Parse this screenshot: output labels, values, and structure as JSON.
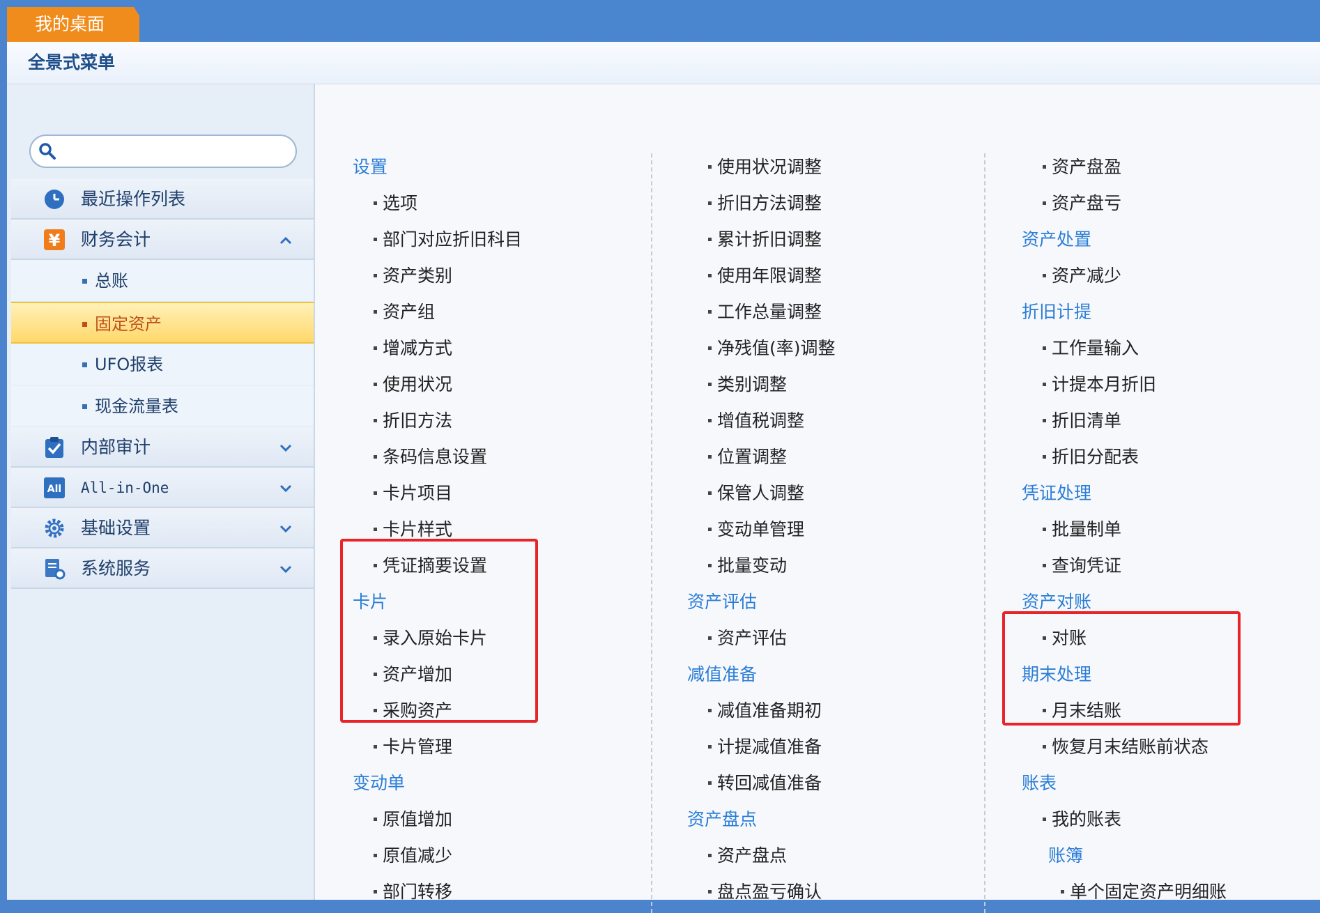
{
  "topbar": {
    "tab_label": "我的桌面"
  },
  "panel": {
    "title": "全景式菜单"
  },
  "search": {
    "placeholder": ""
  },
  "sidebar": {
    "groups": [
      {
        "label": "最近操作列表"
      },
      {
        "label": "财务会计",
        "expanded": true
      },
      {
        "label": "内部审计"
      },
      {
        "label": "All-in-One"
      },
      {
        "label": "基础设置"
      },
      {
        "label": "系统服务"
      }
    ],
    "sub_items": [
      {
        "label": "总账"
      },
      {
        "label": "固定资产",
        "active": true
      },
      {
        "label": "UFO报表"
      },
      {
        "label": "现金流量表"
      }
    ]
  },
  "columns": {
    "col1": [
      {
        "type": "head",
        "label": "设置"
      },
      {
        "type": "item",
        "label": "选项"
      },
      {
        "type": "item",
        "label": "部门对应折旧科目"
      },
      {
        "type": "item",
        "label": "资产类别"
      },
      {
        "type": "item",
        "label": "资产组"
      },
      {
        "type": "item",
        "label": "增减方式"
      },
      {
        "type": "item",
        "label": "使用状况"
      },
      {
        "type": "item",
        "label": "折旧方法"
      },
      {
        "type": "item",
        "label": "条码信息设置"
      },
      {
        "type": "item",
        "label": "卡片项目"
      },
      {
        "type": "item",
        "label": "卡片样式"
      },
      {
        "type": "item",
        "label": "凭证摘要设置"
      },
      {
        "type": "head",
        "label": "卡片"
      },
      {
        "type": "item",
        "label": "录入原始卡片"
      },
      {
        "type": "item",
        "label": "资产增加"
      },
      {
        "type": "item",
        "label": "采购资产"
      },
      {
        "type": "item",
        "label": "卡片管理"
      },
      {
        "type": "head",
        "label": "变动单"
      },
      {
        "type": "item",
        "label": "原值增加"
      },
      {
        "type": "item",
        "label": "原值减少"
      },
      {
        "type": "item",
        "label": "部门转移"
      }
    ],
    "col2": [
      {
        "type": "item",
        "label": "使用状况调整"
      },
      {
        "type": "item",
        "label": "折旧方法调整"
      },
      {
        "type": "item",
        "label": "累计折旧调整"
      },
      {
        "type": "item",
        "label": "使用年限调整"
      },
      {
        "type": "item",
        "label": "工作总量调整"
      },
      {
        "type": "item",
        "label": "净残值(率)调整"
      },
      {
        "type": "item",
        "label": "类别调整"
      },
      {
        "type": "item",
        "label": "增值税调整"
      },
      {
        "type": "item",
        "label": "位置调整"
      },
      {
        "type": "item",
        "label": "保管人调整"
      },
      {
        "type": "item",
        "label": "变动单管理"
      },
      {
        "type": "item",
        "label": "批量变动"
      },
      {
        "type": "head",
        "label": "资产评估"
      },
      {
        "type": "item",
        "label": "资产评估"
      },
      {
        "type": "head",
        "label": "减值准备"
      },
      {
        "type": "item",
        "label": "减值准备期初"
      },
      {
        "type": "item",
        "label": "计提减值准备"
      },
      {
        "type": "item",
        "label": "转回减值准备"
      },
      {
        "type": "head",
        "label": "资产盘点"
      },
      {
        "type": "item",
        "label": "资产盘点"
      },
      {
        "type": "item",
        "label": "盘点盈亏确认"
      }
    ],
    "col3": [
      {
        "type": "item",
        "label": "资产盘盈"
      },
      {
        "type": "item",
        "label": "资产盘亏"
      },
      {
        "type": "head",
        "label": "资产处置"
      },
      {
        "type": "item",
        "label": "资产减少"
      },
      {
        "type": "head",
        "label": "折旧计提"
      },
      {
        "type": "item",
        "label": "工作量输入"
      },
      {
        "type": "item",
        "label": "计提本月折旧"
      },
      {
        "type": "item",
        "label": "折旧清单"
      },
      {
        "type": "item",
        "label": "折旧分配表"
      },
      {
        "type": "head",
        "label": "凭证处理"
      },
      {
        "type": "item",
        "label": "批量制单"
      },
      {
        "type": "item",
        "label": "查询凭证"
      },
      {
        "type": "head",
        "label": "资产对账"
      },
      {
        "type": "item",
        "label": "对账"
      },
      {
        "type": "head",
        "label": "期末处理"
      },
      {
        "type": "item",
        "label": "月末结账"
      },
      {
        "type": "item",
        "label": "恢复月末结账前状态"
      },
      {
        "type": "head",
        "label": "账表"
      },
      {
        "type": "item",
        "label": "我的账表"
      },
      {
        "type": "subhead",
        "label": "账簿"
      },
      {
        "type": "subitem",
        "label": "单个固定资产明细账"
      }
    ]
  },
  "colors": {
    "topbar": "#4a86cf",
    "tab": "#f08c1c",
    "heading": "#2a7dd6",
    "active_bg": "#ffd86a",
    "highlight": "#e8242a"
  }
}
